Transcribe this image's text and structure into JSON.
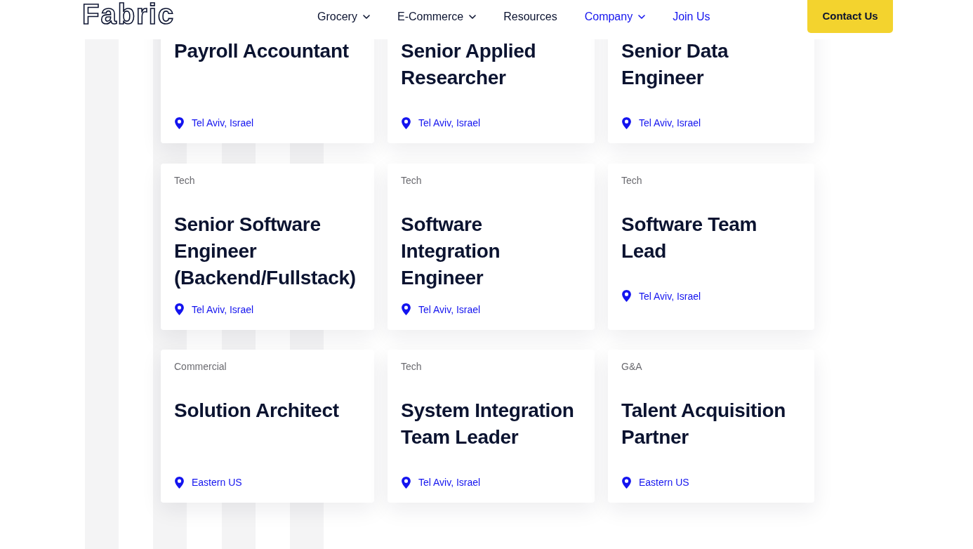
{
  "header": {
    "logo": "Fabric",
    "nav": [
      {
        "label": "Grocery",
        "dropdown": true,
        "highlighted": false
      },
      {
        "label": "E-Commerce",
        "dropdown": true,
        "highlighted": false
      },
      {
        "label": "Resources",
        "dropdown": false,
        "highlighted": false
      },
      {
        "label": "Company",
        "dropdown": true,
        "highlighted": true
      },
      {
        "label": "Join Us",
        "dropdown": false,
        "highlighted": true
      }
    ],
    "contact_button": "Contact Us"
  },
  "jobs": [
    {
      "title": "Payroll Accountant",
      "location": "Tel Aviv, Israel"
    },
    {
      "title": "Senior Applied Researcher",
      "location": "Tel Aviv, Israel"
    },
    {
      "title": "Senior Data Engineer",
      "location": "Tel Aviv, Israel"
    },
    {
      "category": "Tech",
      "title": "Senior Software Engineer (Backend/Fullstack)",
      "location": "Tel Aviv, Israel"
    },
    {
      "category": "Tech",
      "title": "Software Integration Engineer",
      "location": "Tel Aviv, Israel"
    },
    {
      "category": "Tech",
      "title": "Software Team Lead",
      "location": "Tel Aviv, Israel"
    },
    {
      "category": "Commercial",
      "title": "Solution Architect",
      "location": "Eastern US"
    },
    {
      "category": "Tech",
      "title": "System Integration Team Leader",
      "location": "Tel Aviv, Israel"
    },
    {
      "category": "G&A",
      "title": "Talent Acquisition Partner",
      "location": "Eastern US"
    }
  ]
}
